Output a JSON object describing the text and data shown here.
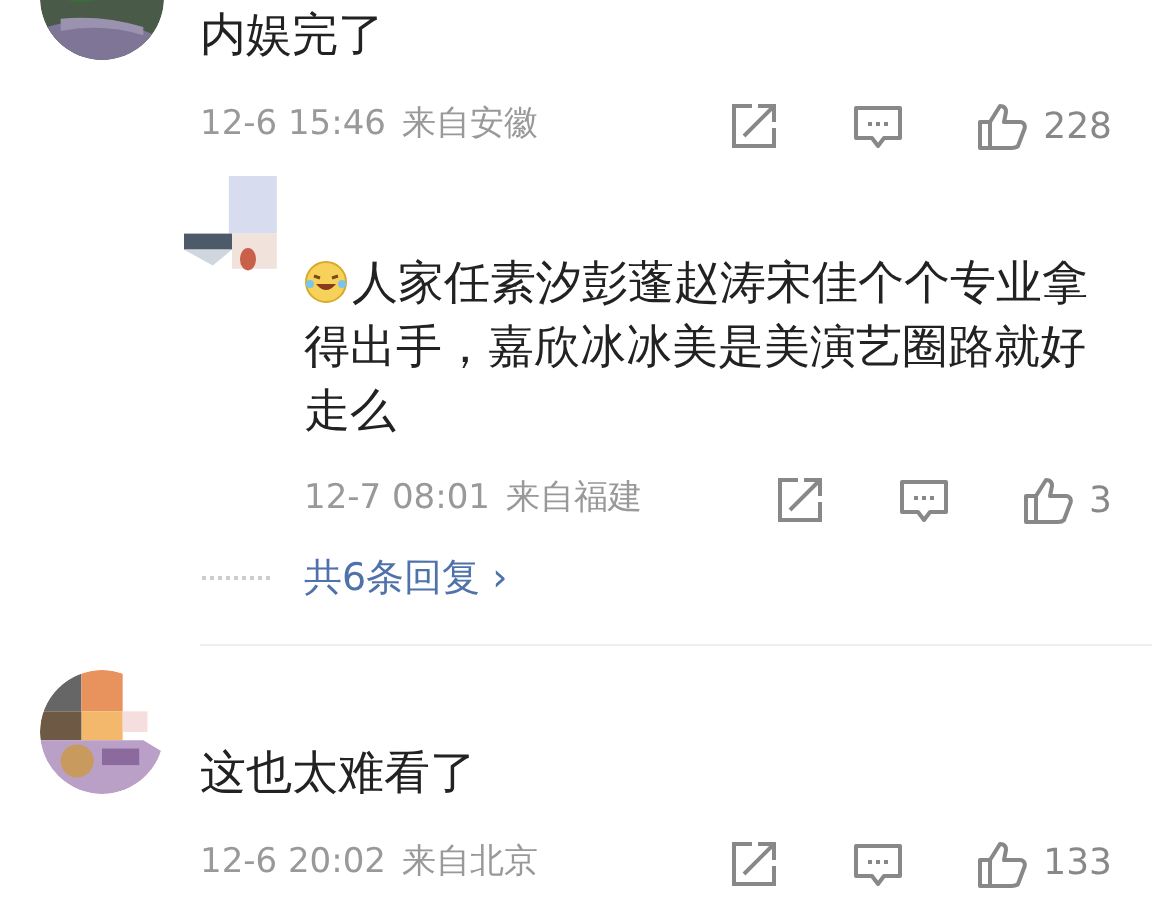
{
  "comments": [
    {
      "kind": "comment",
      "text": "内娱完了",
      "time": "12-6 15:46",
      "location": "来自安徽",
      "likes": "228"
    },
    {
      "kind": "reply",
      "text": "人家任素汐彭蓬赵涛宋佳个个专业拿得出手，嘉欣冰冰美是美演艺圈路就好走么",
      "time": "12-7 08:01",
      "location": "来自福建",
      "likes": "3",
      "more_replies": "共6条回复",
      "more_arrow": "›"
    },
    {
      "kind": "comment",
      "text": "这也太难看了",
      "time": "12-6 20:02",
      "location": "来自北京",
      "likes": "133"
    }
  ]
}
